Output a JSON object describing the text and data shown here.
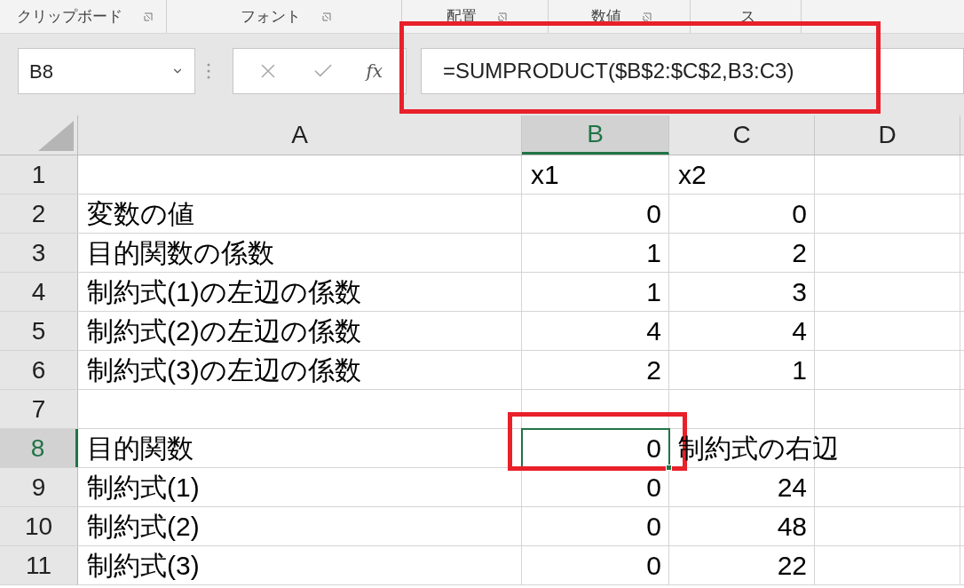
{
  "ribbon": {
    "groups": [
      {
        "label": "クリップボード",
        "launcher": true
      },
      {
        "label": "フォント",
        "launcher": true
      },
      {
        "label": "配置",
        "launcher": true
      },
      {
        "label": "数値",
        "launcher": true
      },
      {
        "label": "ス",
        "launcher": false
      }
    ]
  },
  "name_box": {
    "value": "B8"
  },
  "formula_bar": {
    "function_label": "fx",
    "value": "=SUMPRODUCT($B$2:$C$2,B3:C3)"
  },
  "columns": [
    {
      "label": "A",
      "selected": false
    },
    {
      "label": "B",
      "selected": true
    },
    {
      "label": "C",
      "selected": false
    },
    {
      "label": "D",
      "selected": false
    }
  ],
  "rows": [
    {
      "number": "1",
      "selected": false,
      "cells": [
        {
          "kind": "empty"
        },
        {
          "kind": "text",
          "text": "x1"
        },
        {
          "kind": "text",
          "text": "x2"
        },
        {
          "kind": "empty"
        }
      ]
    },
    {
      "number": "2",
      "selected": false,
      "cells": [
        {
          "kind": "text",
          "text": "変数の値"
        },
        {
          "kind": "number",
          "text": "0"
        },
        {
          "kind": "number",
          "text": "0"
        },
        {
          "kind": "empty"
        }
      ]
    },
    {
      "number": "3",
      "selected": false,
      "cells": [
        {
          "kind": "text",
          "text": "目的関数の係数"
        },
        {
          "kind": "number",
          "text": "1"
        },
        {
          "kind": "number",
          "text": "2"
        },
        {
          "kind": "empty"
        }
      ]
    },
    {
      "number": "4",
      "selected": false,
      "cells": [
        {
          "kind": "text",
          "text": "制約式(1)の左辺の係数"
        },
        {
          "kind": "number",
          "text": "1"
        },
        {
          "kind": "number",
          "text": "3"
        },
        {
          "kind": "empty"
        }
      ]
    },
    {
      "number": "5",
      "selected": false,
      "cells": [
        {
          "kind": "text",
          "text": "制約式(2)の左辺の係数"
        },
        {
          "kind": "number",
          "text": "4"
        },
        {
          "kind": "number",
          "text": "4"
        },
        {
          "kind": "empty"
        }
      ]
    },
    {
      "number": "6",
      "selected": false,
      "cells": [
        {
          "kind": "text",
          "text": "制約式(3)の左辺の係数"
        },
        {
          "kind": "number",
          "text": "2"
        },
        {
          "kind": "number",
          "text": "1"
        },
        {
          "kind": "empty"
        }
      ]
    },
    {
      "number": "7",
      "selected": false,
      "cells": [
        {
          "kind": "empty"
        },
        {
          "kind": "empty"
        },
        {
          "kind": "empty"
        },
        {
          "kind": "empty"
        }
      ]
    },
    {
      "number": "8",
      "selected": true,
      "cells": [
        {
          "kind": "text",
          "text": "目的関数"
        },
        {
          "kind": "number",
          "text": "0",
          "selected": true
        },
        {
          "kind": "text",
          "text": "制約式の右辺"
        },
        {
          "kind": "empty"
        }
      ]
    },
    {
      "number": "9",
      "selected": false,
      "cells": [
        {
          "kind": "text",
          "text": "制約式(1)"
        },
        {
          "kind": "number",
          "text": "0"
        },
        {
          "kind": "number",
          "text": "24"
        },
        {
          "kind": "empty"
        }
      ]
    },
    {
      "number": "10",
      "selected": false,
      "cells": [
        {
          "kind": "text",
          "text": "制約式(2)"
        },
        {
          "kind": "number",
          "text": "0"
        },
        {
          "kind": "number",
          "text": "48"
        },
        {
          "kind": "empty"
        }
      ]
    },
    {
      "number": "11",
      "selected": false,
      "cells": [
        {
          "kind": "text",
          "text": "制約式(3)"
        },
        {
          "kind": "number",
          "text": "0"
        },
        {
          "kind": "number",
          "text": "22"
        },
        {
          "kind": "empty"
        }
      ]
    }
  ]
}
